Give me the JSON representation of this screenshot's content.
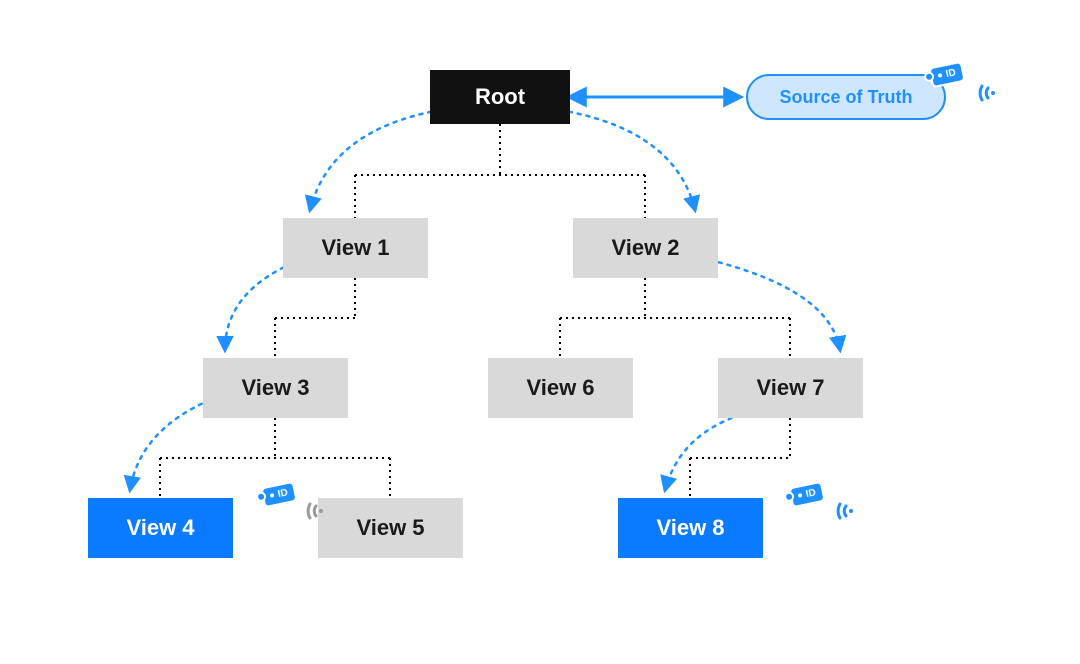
{
  "diagram": {
    "root": "Root",
    "source_of_truth": "Source of Truth",
    "id_tag": "ID",
    "nodes": {
      "view1": "View 1",
      "view2": "View 2",
      "view3": "View 3",
      "view4": "View 4",
      "view5": "View 5",
      "view6": "View 6",
      "view7": "View 7",
      "view8": "View 8"
    },
    "colors": {
      "blue": "#0a7aff",
      "light_blue": "#cfe6ff",
      "link_blue": "#1e90ff",
      "gray": "#d9d9d9",
      "black": "#111"
    }
  }
}
